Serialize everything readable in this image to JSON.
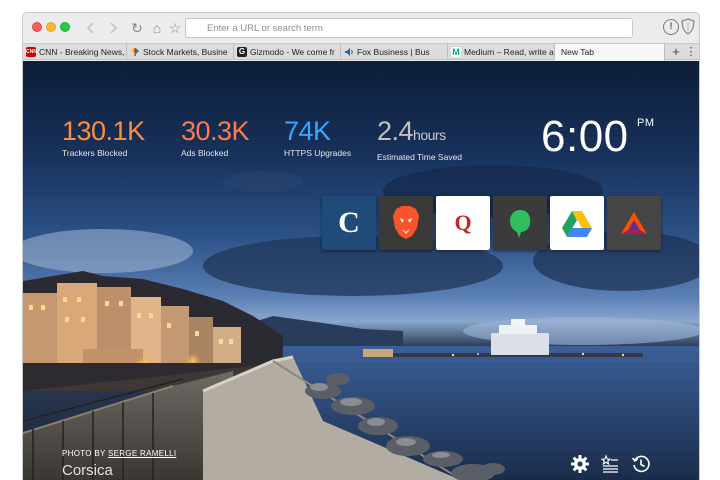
{
  "browser": {
    "url_placeholder": "Enter a URL or search term",
    "nav": {
      "back_icon": "back-arrow-icon",
      "forward_icon": "forward-arrow-icon",
      "reload_glyph": "↻",
      "home_glyph": "⌂",
      "bookmark_glyph": "☆",
      "info_glyph": "!"
    },
    "tabs": [
      {
        "label": "CNN - Breaking News,",
        "favicon": "CNN",
        "favicon_color": "#cc0000",
        "active": false
      },
      {
        "label": "Stock Markets, Busine",
        "favicon": "nbc-peacock-icon",
        "favicon_color": "#6b4fbb",
        "active": false
      },
      {
        "label": "Gizmodo - We come fr",
        "favicon": "G",
        "favicon_color": "#222222",
        "active": false
      },
      {
        "label": "Fox Business | Bus",
        "favicon": "speaker-icon",
        "favicon_color": "#1a5fb4",
        "active": false
      },
      {
        "label": "Medium – Read, write a",
        "favicon": "M",
        "favicon_color": "#02b875",
        "active": false
      },
      {
        "label": "New Tab",
        "favicon": "",
        "favicon_color": "",
        "active": true
      }
    ],
    "new_tab_glyph": "+",
    "menu_glyph": "⋮"
  },
  "stats": [
    {
      "value": "130.1K",
      "unit": "",
      "label": "Trackers Blocked",
      "color": "#ff8c3a"
    },
    {
      "value": "30.3K",
      "unit": "",
      "label": "Ads Blocked",
      "color": "#ff7a4e"
    },
    {
      "value": "74K",
      "unit": "",
      "label": "HTTPS Upgrades",
      "color": "#3aa5ff"
    },
    {
      "value": "2.4",
      "unit": "hours",
      "label": "Estimated Time Saved",
      "color": "#c2c2c2"
    }
  ],
  "clock": {
    "time": "6:00",
    "ampm": "PM"
  },
  "top_sites": [
    {
      "name": "nytimes-tile",
      "glyph": "C",
      "bg": "#1f4b78",
      "fg": "#ffffff"
    },
    {
      "name": "brave-tile",
      "glyph": "brave-lion-icon",
      "bg": "#3a3a3a",
      "fg": "#fb542b"
    },
    {
      "name": "quora-tile",
      "glyph": "Q",
      "bg": "#ffffff",
      "fg": "#b92b27"
    },
    {
      "name": "evernote-tile",
      "glyph": "evernote-icon",
      "bg": "#3b3b3b",
      "fg": "#2dbe60"
    },
    {
      "name": "google-drive-tile",
      "glyph": "google-drive-icon",
      "bg": "#ffffff",
      "fg": "#1fa463"
    },
    {
      "name": "bat-tile",
      "glyph": "bat-triangle-icon",
      "bg": "#454545",
      "fg": "#ff5000"
    }
  ],
  "photo": {
    "credit_prefix": "PHOTO BY ",
    "credit_author": "SERGE RAMELLI",
    "location": "Corsica"
  },
  "controls": {
    "settings_icon": "gear-icon",
    "bookmarks_icon": "bookmarks-list-icon",
    "history_icon": "history-clock-icon"
  }
}
